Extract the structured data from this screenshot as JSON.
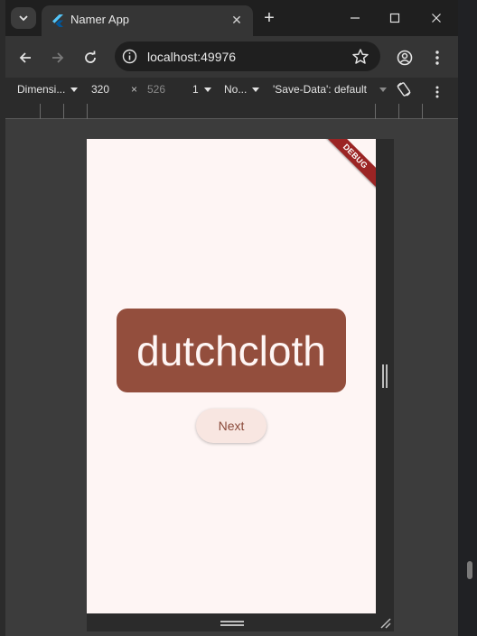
{
  "browser": {
    "tab": {
      "title": "Namer App",
      "close_glyph": "✕"
    },
    "new_tab_glyph": "+",
    "omnibox": {
      "url": "localhost:49976"
    },
    "colors": {
      "chrome_dark": "#1f1f1f",
      "toolbar": "#353535"
    }
  },
  "device_toolbar": {
    "dimensions_label": "Dimensi...",
    "width_value": "320",
    "times_glyph": "×",
    "height_value": "526",
    "dpr_label": "1",
    "throttle_label": "No...",
    "save_data_label": "'Save-Data': default"
  },
  "app": {
    "debug_banner": "DEBUG",
    "word": "dutchcloth",
    "next_label": "Next",
    "colors": {
      "background": "#fef5f4",
      "card": "#934e3d",
      "button": "#f8e6e1"
    }
  }
}
